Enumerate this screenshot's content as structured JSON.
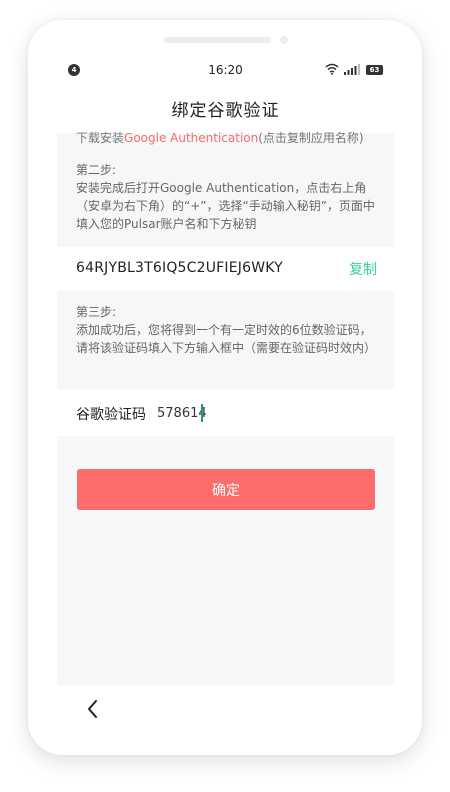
{
  "status_bar": {
    "notification_count": "4",
    "time": "16:20",
    "battery": "63"
  },
  "header": {
    "title": "绑定谷歌验证"
  },
  "step1_partial": {
    "prefix": "下载安装",
    "link": "Google Authentication",
    "suffix": "(点击复制应用名称)"
  },
  "step2": {
    "title": "第二步:",
    "text": "安装完成后打开Google Authentication，点击右上角（安卓为右下角）的“+”，选择“手动输入秘钥”，页面中填入您的Pulsar账户名和下方秘钥"
  },
  "secret": {
    "key": "64RJYBL3T6IQ5C2UFIEJ6WKY",
    "copy_label": "复制"
  },
  "step3": {
    "title": "第三步:",
    "text": "添加成功后，您将得到一个有一定时效的6位数验证码，请将该验证码填入下方输入框中（需要在验证码时效内）"
  },
  "code": {
    "label": "谷歌验证码",
    "value": "578614"
  },
  "confirm_label": "确定",
  "colors": {
    "accent_red": "#fc6c6b",
    "accent_green": "#3ccf9a",
    "link_red": "#f36f6f"
  },
  "icons": {
    "back": "chevron-left-icon",
    "wifi": "wifi-icon",
    "signal": "signal-icon",
    "battery": "battery-icon"
  }
}
